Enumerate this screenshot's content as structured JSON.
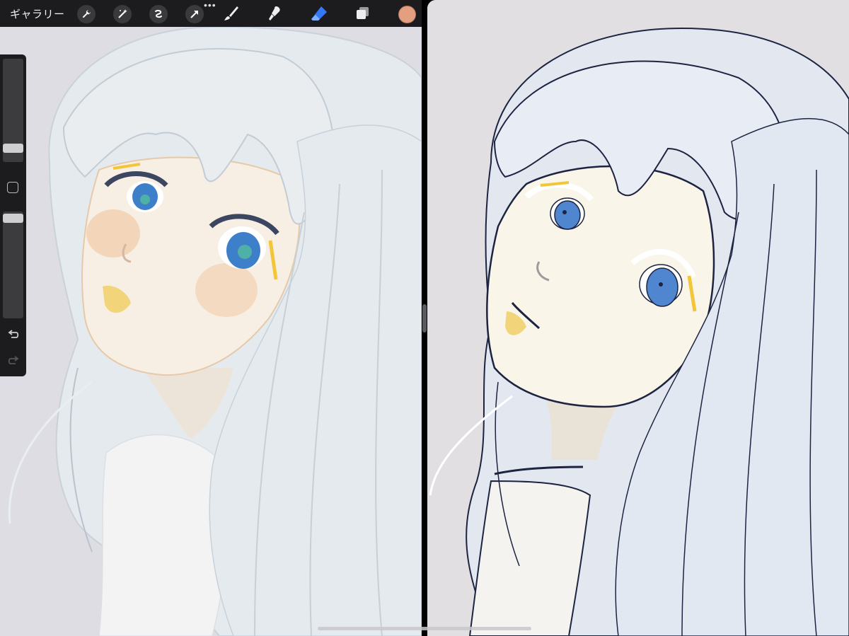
{
  "toolbar": {
    "gallery_label": "ギャラリー",
    "icons": [
      "wrench-icon",
      "magic-wand-icon",
      "selection-icon",
      "transform-arrow-icon",
      "brush-icon",
      "smudge-icon",
      "eraser-icon",
      "layers-icon"
    ],
    "more_label": "•••",
    "active_tool": "eraser",
    "active_color": "#e39f80",
    "accent_color": "#3478f6"
  },
  "sidebar": {
    "brush_size": 0.9,
    "brush_opacity": 0.02,
    "controls": [
      "size-slider",
      "modify-button",
      "opacity-slider",
      "undo-arrow-icon",
      "redo-arrow-icon"
    ]
  },
  "canvas": {
    "left_artwork": "painted-illustration",
    "right_artwork": "line-art-illustration",
    "background_color": "#dedde3",
    "hair_color": "#e6ebef",
    "skin_color": "#f6efe4",
    "eye_color": "#3d80c8",
    "line_color": "#1c2442"
  }
}
